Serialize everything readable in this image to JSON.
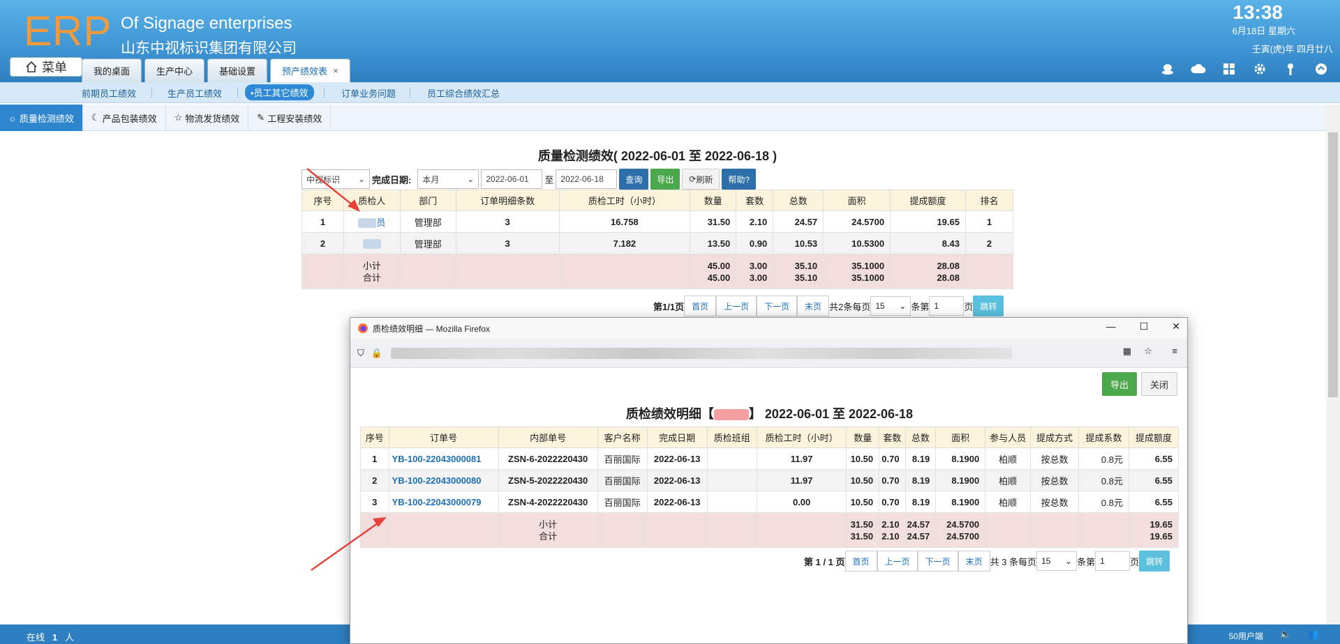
{
  "header": {
    "logo": "ERP",
    "company_en": "Of Signage enterprises",
    "company_cn": "山东中视标识集团有限公司",
    "time": "13:38",
    "date": "6月18日 星期六",
    "lunar": "壬寅(虎)年 四月廿八",
    "menu_label": "菜单",
    "tabs": [
      {
        "label": "我的桌面"
      },
      {
        "label": "生产中心"
      },
      {
        "label": "基础设置"
      },
      {
        "label": "预产绩效表",
        "close": "×"
      }
    ]
  },
  "subnav": {
    "items": [
      "前期员工绩效",
      "生产员工绩效",
      "•员工其它绩效",
      "订单业务问题",
      "员工综合绩效汇总"
    ]
  },
  "section_tabs": [
    "质量检测绩效",
    "产品包装绩效",
    "物流发货绩效",
    "工程安装绩效"
  ],
  "report": {
    "title": "质量检测绩效( 2022-06-01 至 2022-06-18 )",
    "filters": {
      "company": "中视标识",
      "date_label": "完成日期:",
      "period": "本月",
      "from": "2022-06-01",
      "to_label": "至",
      "to": "2022-06-18",
      "query": "查询",
      "export": "导出",
      "refresh": "刷新",
      "help": "帮助?"
    },
    "columns": [
      "序号",
      "质检人",
      "部门",
      "订单明细条数",
      "质检工时（小时）",
      "数量",
      "套数",
      "总数",
      "面积",
      "提成额度",
      "排名"
    ],
    "rows": [
      {
        "no": "1",
        "person": "员",
        "dept": "管理部",
        "count": "3",
        "hours": "16.758",
        "qty": "31.50",
        "sets": "2.10",
        "total": "24.57",
        "area": "24.5700",
        "amount": "19.65",
        "rank": "1"
      },
      {
        "no": "2",
        "person": "",
        "dept": "管理部",
        "count": "3",
        "hours": "7.182",
        "qty": "13.50",
        "sets": "0.90",
        "total": "10.53",
        "area": "10.5300",
        "amount": "8.43",
        "rank": "2"
      }
    ],
    "subtotal_label": "小计",
    "total_label": "合计",
    "subtotal": {
      "qty": "45.00",
      "sets": "3.00",
      "total": "35.10",
      "area": "35.1000",
      "amount": "28.08"
    },
    "grand": {
      "qty": "45.00",
      "sets": "3.00",
      "total": "35.10",
      "area": "35.1000",
      "amount": "28.08"
    },
    "pager": {
      "page_info": "第1/1页",
      "first": "首页",
      "prev": "上一页",
      "next": "下一页",
      "last": "末页",
      "count": "共2条每页",
      "per_page": "15",
      "goto_label": "条第",
      "goto_value": "1",
      "page_unit": "页",
      "jump": "跳转"
    }
  },
  "popup": {
    "window_title": "质检绩效明细 — Mozilla Firefox",
    "export": "导出",
    "close": "关闭",
    "title_prefix": "质检绩效明细【",
    "title_suffix": "】 2022-06-01 至 2022-06-18",
    "columns": [
      "序号",
      "订单号",
      "内部单号",
      "客户名称",
      "完成日期",
      "质检班组",
      "质检工时（小时）",
      "数量",
      "套数",
      "总数",
      "面积",
      "参与人员",
      "提成方式",
      "提成系数",
      "提成额度"
    ],
    "rows": [
      {
        "no": "1",
        "order": "YB-100-22043000081",
        "inner": "ZSN-6-2022220430",
        "customer": "百丽国际",
        "date": "2022-06-13",
        "group": "",
        "hours": "11.97",
        "qty": "10.50",
        "sets": "0.70",
        "total": "8.19",
        "area": "8.1900",
        "people": "柏顺",
        "method": "按总数",
        "ratio": "0.8元",
        "amount": "6.55"
      },
      {
        "no": "2",
        "order": "YB-100-22043000080",
        "inner": "ZSN-5-2022220430",
        "customer": "百丽国际",
        "date": "2022-06-13",
        "group": "",
        "hours": "11.97",
        "qty": "10.50",
        "sets": "0.70",
        "total": "8.19",
        "area": "8.1900",
        "people": "柏顺",
        "method": "按总数",
        "ratio": "0.8元",
        "amount": "6.55"
      },
      {
        "no": "3",
        "order": "YB-100-22043000079",
        "inner": "ZSN-4-2022220430",
        "customer": "百丽国际",
        "date": "2022-06-13",
        "group": "",
        "hours": "0.00",
        "qty": "10.50",
        "sets": "0.70",
        "total": "8.19",
        "area": "8.1900",
        "people": "柏顺",
        "method": "按总数",
        "ratio": "0.8元",
        "amount": "6.55"
      }
    ],
    "subtotal_label": "小计",
    "total_label": "合计",
    "subtotal": {
      "qty": "31.50",
      "sets": "2.10",
      "total": "24.57",
      "area": "24.5700",
      "amount": "19.65"
    },
    "grand": {
      "qty": "31.50",
      "sets": "2.10",
      "total": "24.57",
      "area": "24.5700",
      "amount": "19.65"
    },
    "pager": {
      "page_info": "第 1 / 1 页",
      "first": "首页",
      "prev": "上一页",
      "next": "下一页",
      "last": "末页",
      "count": "共 3 条每页",
      "per_page": "15",
      "goto_label": "条第",
      "goto_value": "1",
      "page_unit": "页",
      "jump": "跳转"
    }
  },
  "statusbar": {
    "online_label": "在线",
    "online_count": "1",
    "online_unit": "人",
    "license": "50用户端"
  },
  "colors": {
    "header": "#3a8fcf",
    "logo": "#f39a3d",
    "table_header": "#fcf3dc",
    "summary_row": "#f3dede",
    "link": "#1d6fb8",
    "arrow": "#e8413a"
  }
}
